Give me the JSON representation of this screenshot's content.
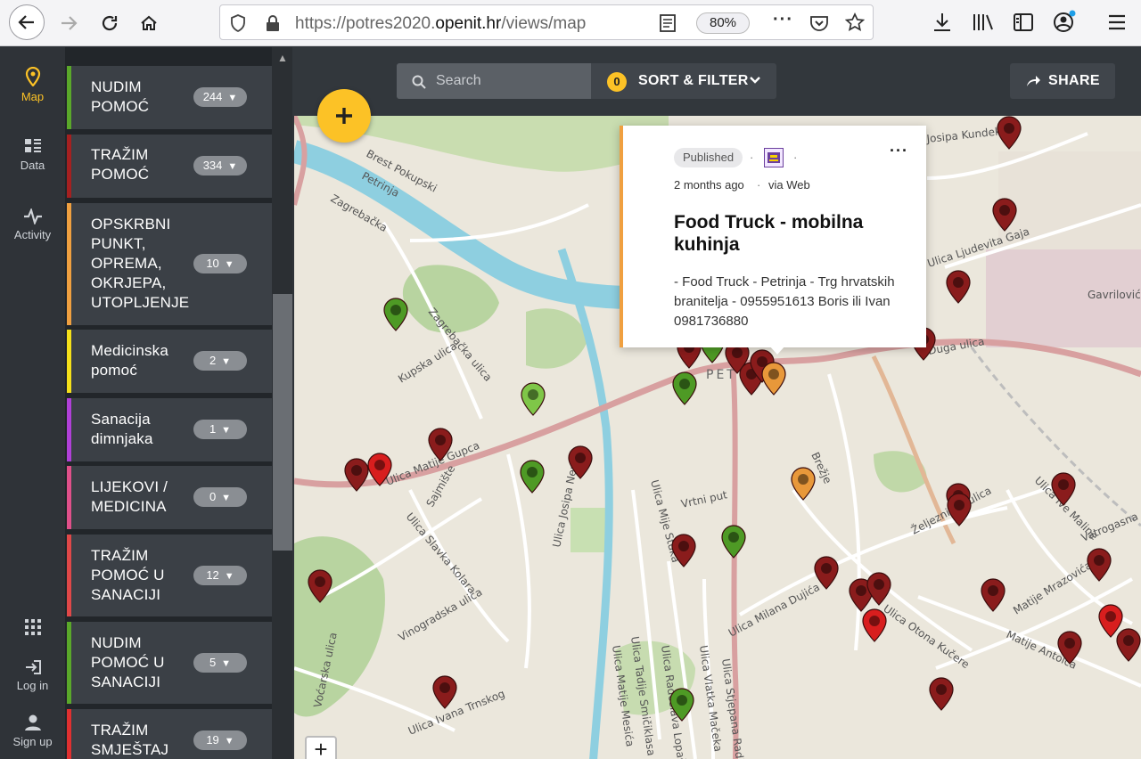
{
  "browser": {
    "url_prefix": "https://potres2020.",
    "url_domain": "openit.hr",
    "url_path": "/views/map",
    "zoom": "80%"
  },
  "nav": {
    "map": "Map",
    "data": "Data",
    "activity": "Activity",
    "login": "Log in",
    "signup": "Sign up"
  },
  "filters": [
    {
      "label": "NUDIM POMOĆ",
      "count": "244",
      "color": "#5aa82a"
    },
    {
      "label": "TRAŽIM POMOĆ",
      "count": "334",
      "color": "#a52020"
    },
    {
      "label": "OPSKRBNI PUNKT, OPREMA, OKRJEPA, UTOPLJENJE",
      "count": "10",
      "color": "#f0a040"
    },
    {
      "label": "Medicinska pomoć",
      "count": "2",
      "color": "#f5e01a"
    },
    {
      "label": "Sanacija dimnjaka",
      "count": "1",
      "color": "#b040d8"
    },
    {
      "label": "LIJEKOVI / MEDICINA",
      "count": "0",
      "color": "#e0508a"
    },
    {
      "label": "TRAŽIM POMOĆ U SANACIJI",
      "count": "12",
      "color": "#e04848"
    },
    {
      "label": "NUDIM POMOĆ U SANACIJI",
      "count": "5",
      "color": "#5aa82a"
    },
    {
      "label": "TRAŽIM SMJEŠTAJ",
      "count": "19",
      "color": "#e03030"
    }
  ],
  "toolbar": {
    "search_placeholder": "Search",
    "filter_count": "0",
    "sort_filter": "SORT & FILTER",
    "share": "SHARE"
  },
  "popup": {
    "status": "Published",
    "time": "2 months ago",
    "via": "via Web",
    "title": "Food Truck - mobilna kuhinja",
    "body": "- Food Truck - Petrinja - Trg hrvatskih branitelja - 0955951613 Boris ili Ivan 0981736880"
  },
  "map": {
    "labels": [
      {
        "text": "Brest Pokupski"
      },
      {
        "text": "Petrinja"
      },
      {
        "text": "Zagrebačka"
      },
      {
        "text": "Zagrebačka ulica"
      },
      {
        "text": "Kupska ulica"
      },
      {
        "text": "Ulica Matije Gupca"
      },
      {
        "text": "Sajmište"
      },
      {
        "text": "Ulica Slavka Kolara"
      },
      {
        "text": "Ulica Josipa Neme"
      },
      {
        "text": "Vinogradska ulica"
      },
      {
        "text": "Voćarska ulica"
      },
      {
        "text": "Ulica Ivana Trnskog"
      },
      {
        "text": "Ulica Mije Stuka"
      },
      {
        "text": "Vrtni put"
      },
      {
        "text": "Ulica Tadije Smičiklasa"
      },
      {
        "text": "Ulica Matije Mesića"
      },
      {
        "text": "Ulica Radoslava Lopašića"
      },
      {
        "text": "Ulica Vlatka Mačeka"
      },
      {
        "text": "Ulica Stjepana Radića"
      },
      {
        "text": "Ulica Milana Dujića"
      },
      {
        "text": "Brežje"
      },
      {
        "text": "PET"
      },
      {
        "text": "Ulica Otona Kučere"
      },
      {
        "text": "Matije Antolca"
      },
      {
        "text": "Matije Mrazovića"
      },
      {
        "text": "Vatrogasna"
      },
      {
        "text": "Ulica Ive Maline"
      },
      {
        "text": "Željeznička ulica"
      },
      {
        "text": "Duga ulica"
      },
      {
        "text": "Ulica Ljudevita Gaja"
      },
      {
        "text": "Gavrilović"
      },
      {
        "text": "Josipa Kundeka"
      }
    ],
    "pin_colors": {
      "dark_red": "#8a1c1c",
      "red": "#d81e1e",
      "green": "#4e9a25",
      "light_green": "#7fc648",
      "orange": "#e8983a"
    }
  }
}
